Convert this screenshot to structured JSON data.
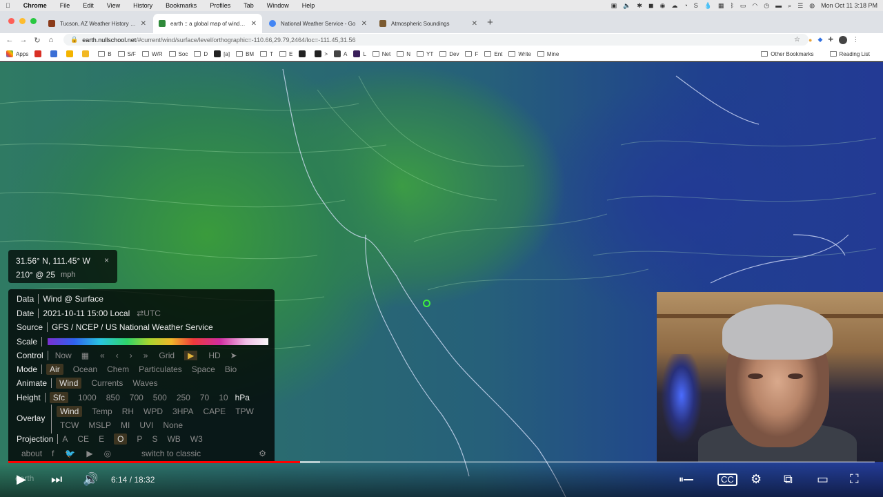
{
  "menubar": {
    "app": "Chrome",
    "items": [
      "File",
      "Edit",
      "View",
      "History",
      "Bookmarks",
      "Profiles",
      "Tab",
      "Window",
      "Help"
    ],
    "clock": "Mon Oct 11  3:18 PM"
  },
  "tabs": [
    {
      "title": "Tucson, AZ Weather History | W",
      "color": "#8a3a1a"
    },
    {
      "title": "earth :: a global map of wind, w",
      "color": "#2f8a3a"
    },
    {
      "title": "National Weather Service - Go",
      "color": "#4285f4"
    },
    {
      "title": "Atmospheric Soundings",
      "color": "#7b5a30"
    }
  ],
  "address": {
    "host": "earth.nullschool.net",
    "path": "/#current/wind/surface/level/orthographic=-110.66,29.79,2464/loc=-111.45,31.56"
  },
  "bookmarks": [
    {
      "label": "Apps",
      "kind": "grid"
    },
    {
      "label": "",
      "kind": "gmail",
      "color": "#d93025"
    },
    {
      "label": "",
      "kind": "sq",
      "color": "#3b6fd6"
    },
    {
      "label": "",
      "kind": "sq",
      "color": "#f4b400"
    },
    {
      "label": "",
      "kind": "sq",
      "color": "#f2b823"
    },
    {
      "label": "B",
      "kind": "folder"
    },
    {
      "label": "S/F",
      "kind": "folder"
    },
    {
      "label": "W/R",
      "kind": "folder"
    },
    {
      "label": "Soc",
      "kind": "folder"
    },
    {
      "label": "D",
      "kind": "folder"
    },
    {
      "label": "[a]",
      "kind": "sq",
      "color": "#222"
    },
    {
      "label": "BM",
      "kind": "folder"
    },
    {
      "label": "T",
      "kind": "folder"
    },
    {
      "label": "E",
      "kind": "folder"
    },
    {
      "label": "",
      "kind": "sq",
      "color": "#222"
    },
    {
      "label": ">",
      "kind": "sq",
      "color": "#222"
    },
    {
      "label": "A",
      "kind": "sq",
      "color": "#444"
    },
    {
      "label": "L",
      "kind": "sq",
      "color": "#3a1f5a"
    },
    {
      "label": "Net",
      "kind": "folder"
    },
    {
      "label": "N",
      "kind": "folder"
    },
    {
      "label": "YT",
      "kind": "folder"
    },
    {
      "label": "Dev",
      "kind": "folder"
    },
    {
      "label": "F",
      "kind": "folder"
    },
    {
      "label": "Ent",
      "kind": "folder"
    },
    {
      "label": "Write",
      "kind": "folder"
    },
    {
      "label": "Mine",
      "kind": "folder"
    }
  ],
  "bookmarks_right": [
    "Other Bookmarks",
    "Reading List"
  ],
  "location": {
    "coords": "31.56° N, 111.45° W",
    "wind": "210° @ 25",
    "unit": "mph",
    "close": "×"
  },
  "menu": {
    "data": {
      "label": "Data",
      "value": "Wind @ Surface"
    },
    "date": {
      "label": "Date",
      "value": "2021-10-11 15:00 Local",
      "toggle": "⇄UTC"
    },
    "source": {
      "label": "Source",
      "value": "GFS / NCEP / US National Weather Service"
    },
    "scale": {
      "label": "Scale"
    },
    "control": {
      "label": "Control",
      "now": "Now",
      "grid": "Grid",
      "hd": "HD"
    },
    "mode": {
      "label": "Mode",
      "options": [
        "Air",
        "Ocean",
        "Chem",
        "Particulates",
        "Space",
        "Bio"
      ],
      "selected": "Air"
    },
    "animate": {
      "label": "Animate",
      "options": [
        "Wind",
        "Currents",
        "Waves"
      ],
      "selected": "Wind"
    },
    "height": {
      "label": "Height",
      "options": [
        "Sfc",
        "1000",
        "850",
        "700",
        "500",
        "250",
        "70",
        "10"
      ],
      "unit": "hPa",
      "selected": "Sfc"
    },
    "overlay": {
      "label": "Overlay",
      "row1": [
        "Wind",
        "Temp",
        "RH",
        "WPD",
        "3HPA",
        "CAPE",
        "TPW"
      ],
      "row2": [
        "TCW",
        "MSLP",
        "MI",
        "UVI",
        "None"
      ],
      "selected": "Wind"
    },
    "projection": {
      "label": "Projection",
      "options": [
        "A",
        "CE",
        "E",
        "O",
        "P",
        "S",
        "WB",
        "W3"
      ],
      "selected": "O"
    },
    "footer": {
      "about": "about",
      "classic": "switch to classic"
    }
  },
  "video": {
    "current": "6:14",
    "duration": "18:32",
    "progress": 0.337,
    "buffered": 0.36,
    "watermark": "earth"
  }
}
